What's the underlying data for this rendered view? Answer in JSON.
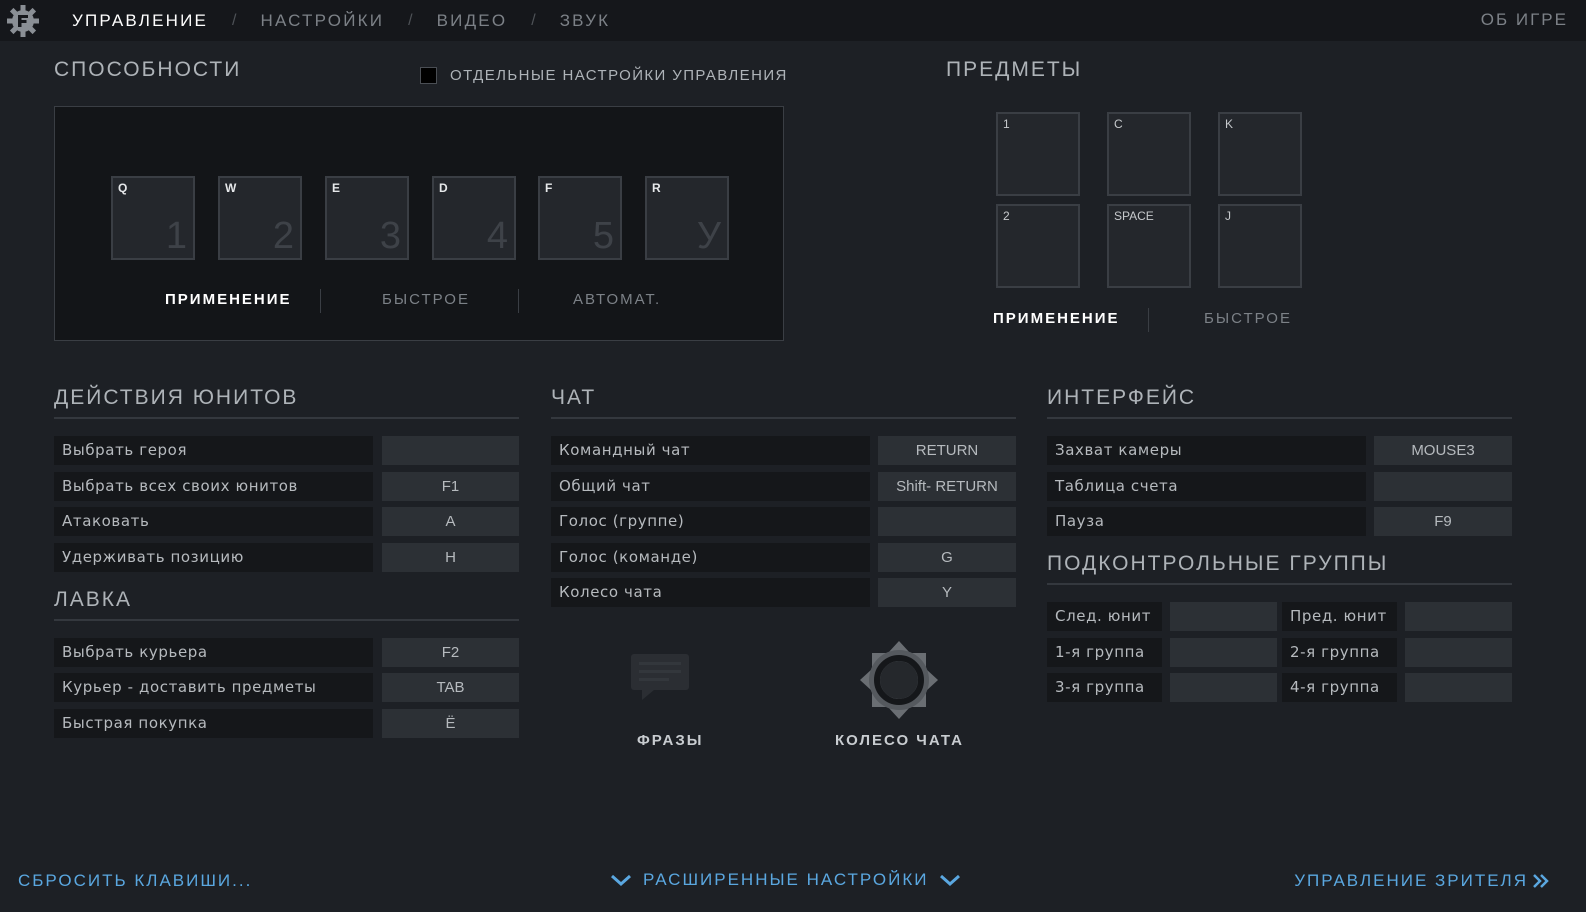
{
  "nav": {
    "items": [
      "УПРАВЛЕНИЕ",
      "НАСТРОЙКИ",
      "ВИДЕО",
      "ЗВУК"
    ],
    "separator": "/",
    "about": "ОБ ИГРЕ"
  },
  "abilities": {
    "title": "СПОСОБНОСТИ",
    "separate_settings": "ОТДЕЛЬНЫЕ НАСТРОЙКИ УПРАВЛЕНИЯ",
    "slots": [
      {
        "key": "Q",
        "num": "1"
      },
      {
        "key": "W",
        "num": "2"
      },
      {
        "key": "E",
        "num": "3"
      },
      {
        "key": "D",
        "num": "4"
      },
      {
        "key": "F",
        "num": "5"
      },
      {
        "key": "R",
        "num": "У"
      }
    ],
    "modes": [
      "ПРИМЕНЕНИЕ",
      "БЫСТРОЕ",
      "АВТОМАТ."
    ]
  },
  "items": {
    "title": "ПРЕДМЕТЫ",
    "slots": [
      "1",
      "C",
      "K",
      "2",
      "SPACE",
      "J"
    ],
    "modes": [
      "ПРИМЕНЕНИЕ",
      "БЫСТРОЕ"
    ]
  },
  "unit_actions": {
    "title": "ДЕЙСТВИЯ ЮНИТОВ",
    "rows": [
      {
        "label": "Выбрать героя",
        "key": ""
      },
      {
        "label": "Выбрать всех своих юнитов",
        "key": "F1"
      },
      {
        "label": "Атаковать",
        "key": "A"
      },
      {
        "label": "Удерживать позицию",
        "key": "H"
      }
    ]
  },
  "shop": {
    "title": "ЛАВКА",
    "rows": [
      {
        "label": "Выбрать курьера",
        "key": "F2"
      },
      {
        "label": "Курьер - доставить предметы",
        "key": "TAB"
      },
      {
        "label": "Быстрая покупка",
        "key": "Ё"
      }
    ]
  },
  "chat": {
    "title": "ЧАТ",
    "rows": [
      {
        "label": "Командный чат",
        "key": "RETURN"
      },
      {
        "label": "Общий чат",
        "key": "Shift- RETURN"
      },
      {
        "label": "Голос (группе)",
        "key": ""
      },
      {
        "label": "Голос (команде)",
        "key": "G"
      },
      {
        "label": "Колесо чата",
        "key": "Y"
      }
    ],
    "phrases": "ФРАЗЫ",
    "wheel": "КОЛЕСО ЧАТА"
  },
  "interface": {
    "title": "ИНТЕРФЕЙС",
    "rows": [
      {
        "label": "Захват камеры",
        "key": "MOUSE3"
      },
      {
        "label": "Таблица счета",
        "key": ""
      },
      {
        "label": "Пауза",
        "key": "F9"
      }
    ]
  },
  "control_groups": {
    "title": "ПОДКОНТРОЛЬНЫЕ ГРУППЫ",
    "rows": [
      [
        {
          "label": "След. юнит",
          "key": ""
        },
        {
          "label": "Пред. юнит",
          "key": ""
        }
      ],
      [
        {
          "label": "1-я группа",
          "key": ""
        },
        {
          "label": "2-я группа",
          "key": ""
        }
      ],
      [
        {
          "label": "3-я группа",
          "key": ""
        },
        {
          "label": "4-я группа",
          "key": ""
        }
      ]
    ]
  },
  "footer": {
    "reset": "СБРОСИТЬ КЛАВИШИ...",
    "advanced": "РАСШИРЕННЫЕ НАСТРОЙКИ",
    "spectator": "УПРАВЛЕНИЕ ЗРИТЕЛЯ"
  },
  "colors": {
    "background": "#1d2025",
    "topbar": "#15171b",
    "accent_link": "#5aa7e0"
  }
}
